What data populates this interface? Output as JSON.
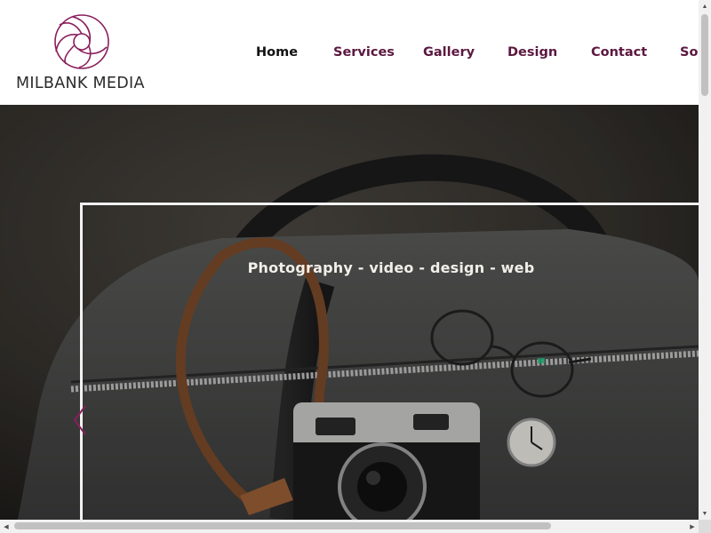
{
  "brand": {
    "name": "MILBANK MEDIA",
    "accent_color": "#8a1f5c",
    "icon": "aperture-icon"
  },
  "nav": {
    "items": [
      {
        "label": "Home",
        "active": true
      },
      {
        "label": "Services",
        "active": false
      },
      {
        "label": "Gallery",
        "active": false
      },
      {
        "label": "Design",
        "active": false
      },
      {
        "label": "Contact",
        "active": false
      },
      {
        "label": "Soc",
        "active": false
      }
    ],
    "active_color": "#111111",
    "item_color": "#5c1840"
  },
  "hero": {
    "tagline": "Photography - video - design - web",
    "prev_icon": "chevron-left-icon"
  },
  "scrollbars": {
    "vertical": {
      "up_icon": "triangle-up-icon",
      "down_icon": "triangle-down-icon"
    },
    "horizontal": {
      "left_icon": "triangle-left-icon",
      "right_icon": "triangle-right-icon"
    }
  }
}
